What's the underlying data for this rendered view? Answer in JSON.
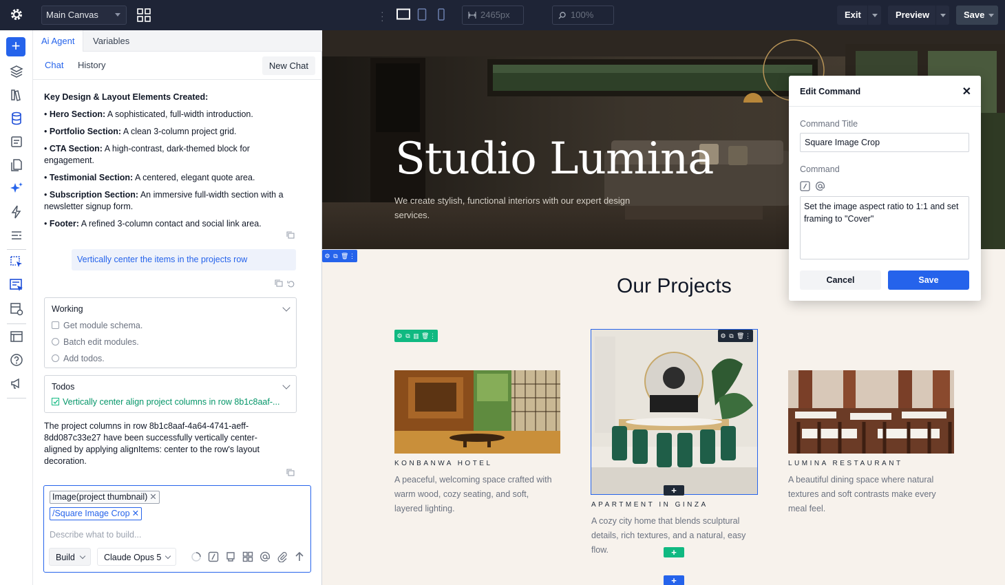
{
  "topbar": {
    "canvas_name": "Main Canvas",
    "width_value": "2465px",
    "zoom_value": "100%",
    "exit_label": "Exit",
    "preview_label": "Preview",
    "save_label": "Save"
  },
  "panel": {
    "tabs": [
      "Ai Agent",
      "Variables"
    ],
    "subtabs": [
      "Chat",
      "History"
    ],
    "new_chat_label": "New Chat",
    "summary": {
      "heading": "Key Design & Layout Elements Created:",
      "items": [
        {
          "label": "Hero Section:",
          "text": "A sophisticated, full-width introduction."
        },
        {
          "label": "Portfolio Section:",
          "text": "A clean 3-column project grid."
        },
        {
          "label": "CTA Section:",
          "text": "A high-contrast, dark-themed block for engagement."
        },
        {
          "label": "Testimonial Section:",
          "text": "A centered, elegant quote area."
        },
        {
          "label": "Subscription Section:",
          "text": "An immersive full-width section with a newsletter signup form."
        },
        {
          "label": "Footer:",
          "text": "A refined 3-column contact and social link area."
        }
      ]
    },
    "user_message": "Vertically center the items in the projects row",
    "working": {
      "title": "Working",
      "steps": [
        "Get module schema.",
        "Batch edit modules.",
        "Add todos."
      ]
    },
    "todos": {
      "title": "Todos",
      "items": [
        "Vertically center align project columns in row 8b1c8aaf-..."
      ]
    },
    "result_message": "The project columns in row 8b1c8aaf-4a64-4741-aeff-8dd087c33e27 have been successfully vertically center-aligned by applying alignItems: center to the row's layout decoration.",
    "composer": {
      "chips": [
        "Image(project thumbnail)",
        "/Square Image Crop"
      ],
      "chip_remove": "✕",
      "placeholder": "Describe what to build...",
      "mode_label": "Build",
      "model_label": "Claude Opus 5"
    }
  },
  "canvas": {
    "hero_title": "Studio Lumina",
    "hero_subtitle": "We create stylish, functional interiors with our expert design services.",
    "projects_title": "Our Projects",
    "projects": [
      {
        "name": "KONBANWA HOTEL",
        "desc": "A peaceful, welcoming space crafted with warm wood, cozy seating, and soft, layered lighting."
      },
      {
        "name": "APARTMENT IN GINZA",
        "desc": "A cozy city home that blends sculptural details, rich textures, and a natural, easy flow."
      },
      {
        "name": "LUMINA RESTAURANT",
        "desc": "A beautiful dining space where natural textures and soft contrasts make every meal feel."
      }
    ],
    "add_glyph": "+"
  },
  "dialog": {
    "title": "Edit Command",
    "close_glyph": "✕",
    "command_title_label": "Command Title",
    "command_title_value": "Square Image Crop",
    "command_label": "Command",
    "command_value": "Set the image aspect ratio to 1:1 and set framing to \"Cover\"",
    "cancel_label": "Cancel",
    "save_label": "Save"
  },
  "colors": {
    "accent": "#2563eb",
    "topbar": "#1e2436",
    "module_bar_green": "#10b981",
    "canvas_bg": "#f7f2ec"
  },
  "icons": [
    "gear-icon",
    "grid-icon",
    "desktop-icon",
    "tablet-icon",
    "phone-icon",
    "width-icon",
    "search-icon",
    "plus-icon",
    "layers-icon",
    "library-icon",
    "database-icon",
    "form-icon",
    "pages-icon",
    "sparkle-icon",
    "bolt-icon",
    "sections-icon",
    "select-icon",
    "select-all-icon",
    "template-icon",
    "layout-icon",
    "help-icon",
    "announce-icon",
    "copy-icon",
    "undo-icon",
    "slash-icon",
    "at-icon",
    "paperclip-icon",
    "send-icon",
    "close-icon"
  ]
}
